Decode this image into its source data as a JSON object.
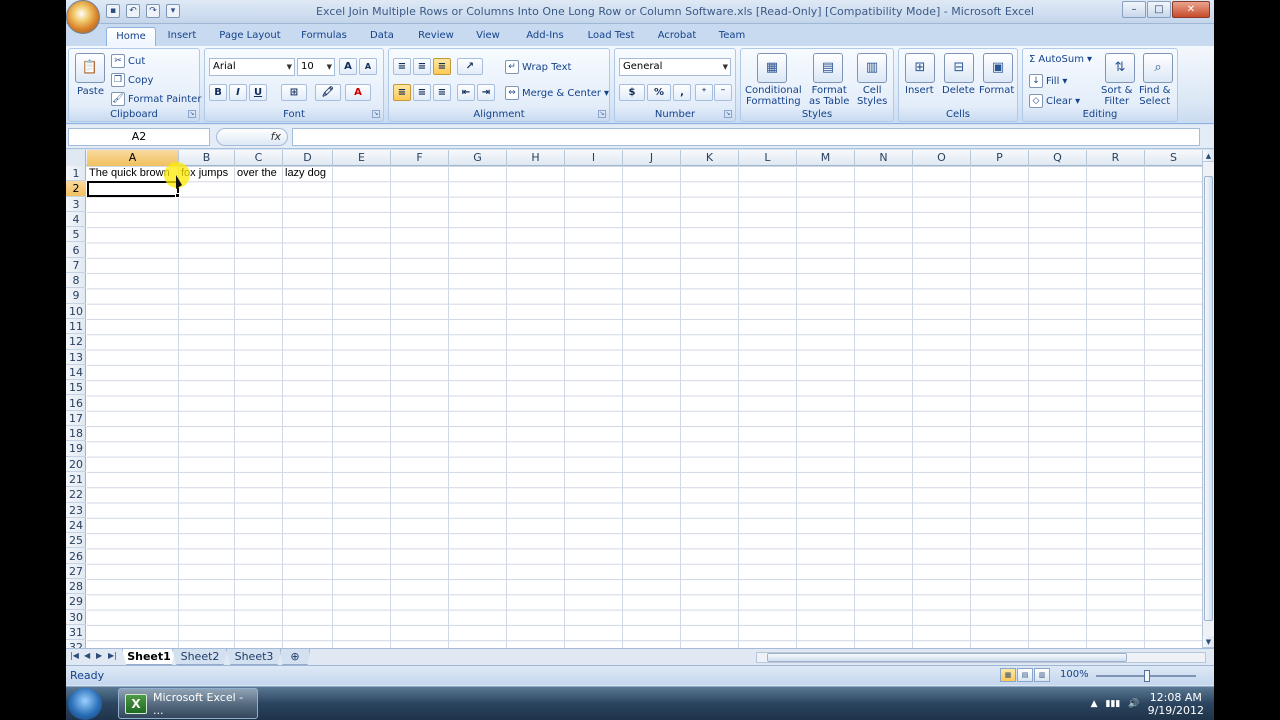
{
  "window": {
    "title": "Excel Join Multiple Rows or Columns Into One Long Row or Column Software.xls [Read-Only] [Compatibility Mode] - Microsoft Excel",
    "controls": [
      "–",
      "□",
      "✕"
    ]
  },
  "ribbon_tabs": [
    "Home",
    "Insert",
    "Page Layout",
    "Formulas",
    "Data",
    "Review",
    "View",
    "Add-Ins",
    "Load Test",
    "Acrobat",
    "Team"
  ],
  "active_tab": "Home",
  "ribbon": {
    "clipboard": {
      "label": "Clipboard",
      "paste": "Paste",
      "cut": "Cut",
      "copy": "Copy",
      "format_painter": "Format Painter"
    },
    "font": {
      "label": "Font",
      "name": "Arial",
      "size": "10",
      "bold": "B",
      "italic": "I",
      "underline": "U"
    },
    "alignment": {
      "label": "Alignment",
      "wrap_text": "Wrap Text",
      "merge_center": "Merge & Center"
    },
    "number": {
      "label": "Number",
      "format": "General",
      "currency": "$",
      "percent": "%",
      "comma": ","
    },
    "styles": {
      "label": "Styles",
      "conditional_1": "Conditional",
      "conditional_2": "Formatting",
      "format_table_1": "Format",
      "format_table_2": "as Table",
      "cell_styles_1": "Cell",
      "cell_styles_2": "Styles"
    },
    "cells": {
      "label": "Cells",
      "insert": "Insert",
      "delete": "Delete",
      "format": "Format"
    },
    "editing": {
      "label": "Editing",
      "autosum": "AutoSum",
      "fill": "Fill",
      "clear": "Clear",
      "sort_1": "Sort &",
      "sort_2": "Filter",
      "find_1": "Find &",
      "find_2": "Select"
    }
  },
  "formula_bar": {
    "name_box": "A2",
    "fx": "fx",
    "content": ""
  },
  "grid": {
    "columns": [
      "A",
      "B",
      "C",
      "D",
      "E",
      "F",
      "G",
      "H",
      "I",
      "J",
      "K",
      "L",
      "M",
      "N",
      "O",
      "P",
      "Q",
      "R",
      "S"
    ],
    "rows": [
      "1",
      "2",
      "3",
      "4",
      "5",
      "6",
      "7",
      "8",
      "9",
      "10",
      "11",
      "12",
      "13",
      "14",
      "15",
      "16",
      "17",
      "18",
      "19",
      "20",
      "21",
      "22",
      "23",
      "24",
      "25",
      "26",
      "27",
      "28",
      "29",
      "30",
      "31",
      "32"
    ],
    "selected_cell": "A2",
    "cells": {
      "A1": "The quick brown",
      "B1": "fox jumps",
      "C1": "over the",
      "D1": "lazy dog"
    }
  },
  "sheets": [
    "Sheet1",
    "Sheet2",
    "Sheet3"
  ],
  "active_sheet": "Sheet1",
  "status": {
    "text": "Ready",
    "zoom": "100%"
  },
  "taskbar": {
    "task_label": "Microsoft Excel - ...",
    "time": "12:08 AM",
    "date": "9/19/2012"
  },
  "colors": {
    "ribbon_bg": "#dce8f6",
    "selection_header": "#f1c15f",
    "grid_line": "#d0d7e5",
    "taskbar": "#2b4560"
  }
}
